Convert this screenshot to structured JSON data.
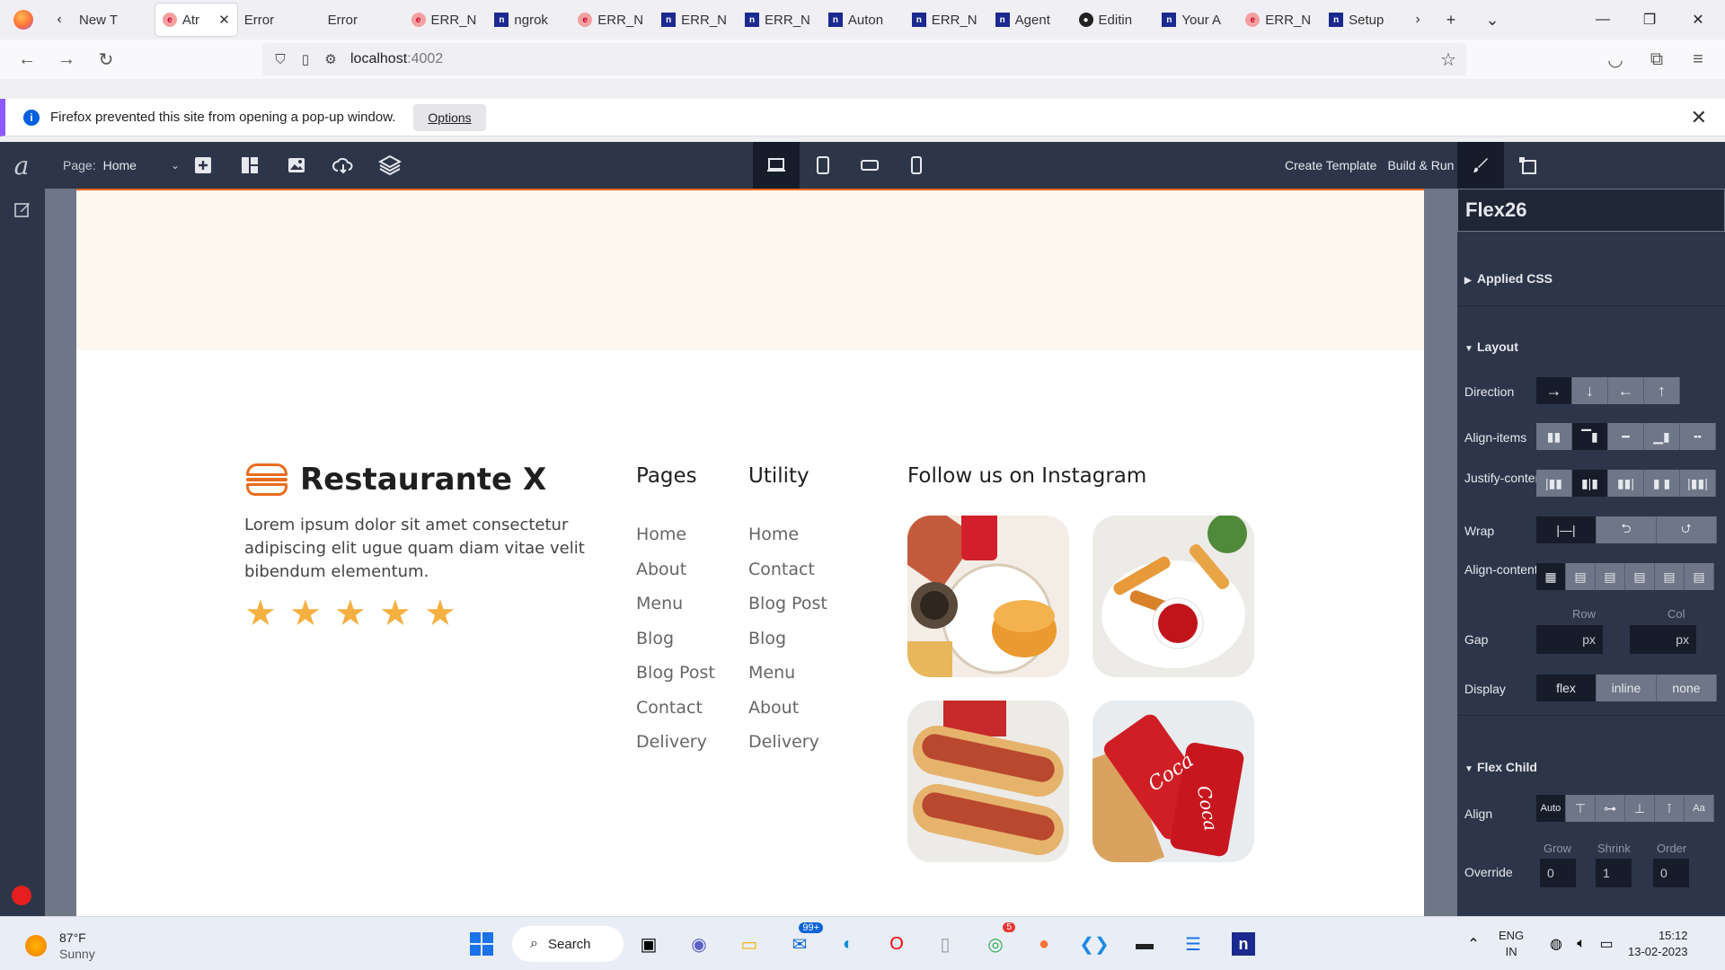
{
  "browser": {
    "tabs": [
      {
        "label": "New T",
        "fav": "",
        "type": "none"
      },
      {
        "label": "Atr",
        "fav": "e",
        "type": "err",
        "active": true
      },
      {
        "label": "Error",
        "fav": "",
        "type": "none"
      },
      {
        "label": "Error",
        "fav": "",
        "type": "none"
      },
      {
        "label": "ERR_N",
        "fav": "e",
        "type": "err"
      },
      {
        "label": "ngrok",
        "fav": "n",
        "type": "n"
      },
      {
        "label": "ERR_N",
        "fav": "e",
        "type": "err"
      },
      {
        "label": "ERR_N",
        "fav": "n",
        "type": "n"
      },
      {
        "label": "ERR_N",
        "fav": "n",
        "type": "n"
      },
      {
        "label": "Auton",
        "fav": "n",
        "type": "n"
      },
      {
        "label": "ERR_N",
        "fav": "n",
        "type": "n"
      },
      {
        "label": "Agent",
        "fav": "n",
        "type": "n"
      },
      {
        "label": "Editin",
        "fav": "gh",
        "type": "gh"
      },
      {
        "label": "Your A",
        "fav": "n",
        "type": "n"
      },
      {
        "label": "ERR_N",
        "fav": "e",
        "type": "err"
      },
      {
        "label": "Setup",
        "fav": "n",
        "type": "n"
      }
    ],
    "url_host": "localhost",
    "url_port": ":4002",
    "notification": {
      "message": "Firefox prevented this site from opening a pop-up window.",
      "options_label": "Options"
    }
  },
  "builder": {
    "page_label": "Page:",
    "page_value": "Home",
    "create_template": "Create Template",
    "build_run": "Build & Run"
  },
  "site": {
    "brand": "Restaurante X",
    "tagline": "Lorem ipsum dolor sit amet consectetur adipiscing elit ugue quam diam vitae velit bibendum elementum.",
    "rating": 5,
    "pages_title": "Pages",
    "pages": [
      "Home",
      "About",
      "Menu",
      "Blog",
      "Blog Post",
      "Contact",
      "Delivery"
    ],
    "utility_title": "Utility",
    "utility": [
      "Home",
      "Contact",
      "Blog Post",
      "Blog",
      "Menu",
      "About",
      "Delivery"
    ],
    "instagram_title": "Follow us on Instagram",
    "photos": [
      "burger-and-soda-photo",
      "fries-with-ketchup-photo",
      "hot-dogs-photo",
      "coca-cola-cans-photo"
    ]
  },
  "panel": {
    "element_name": "Flex26",
    "applied_css": "Applied CSS",
    "layout": "Layout",
    "direction": "Direction",
    "direction_options": [
      "→",
      "↓",
      "←",
      "↑"
    ],
    "align_items": "Align-items",
    "justify": "Justify-content",
    "wrap": "Wrap",
    "align_content": "Align-content",
    "gap": "Gap",
    "row": "Row",
    "col": "Col",
    "gap_unit": "px",
    "display": "Display",
    "display_options": [
      "flex",
      "inline",
      "none"
    ],
    "flex_child": "Flex Child",
    "align": "Align",
    "align_auto": "Auto",
    "override": "Override",
    "grow_label": "Grow",
    "shrink_label": "Shrink",
    "order_label": "Order",
    "grow": "0",
    "shrink": "1",
    "order": "0"
  },
  "taskbar": {
    "temp": "87°F",
    "weather": "Sunny",
    "search": "Search",
    "mail_badge": "99+",
    "chrome_badge": "5",
    "lang": "ENG",
    "region": "IN",
    "time": "15:12",
    "date": "13-02-2023"
  },
  "colors": {
    "accent": "#ea6c1e",
    "builder_bg": "#2d3649",
    "star": "#f5b042"
  }
}
